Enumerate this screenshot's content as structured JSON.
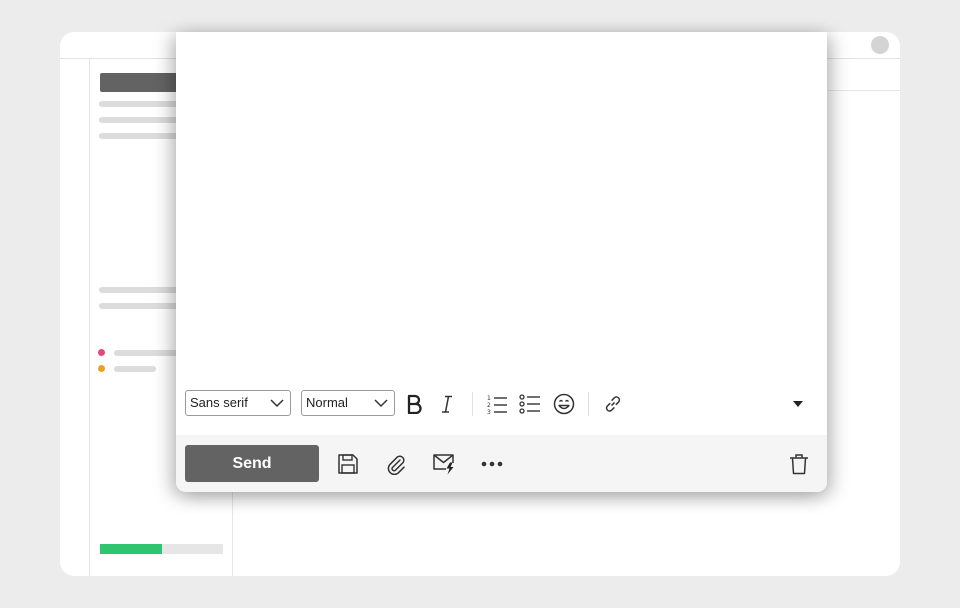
{
  "colors": {
    "background": "#ececec",
    "skeleton": "#dcdcdc",
    "button_dark": "#636363",
    "tag_pink": "#e8467c",
    "tag_orange": "#f0a020",
    "storage_green": "#2fc46f"
  },
  "sidebar": {
    "storage_used_fraction": 0.5
  },
  "compose": {
    "font_select": {
      "value": "Sans serif"
    },
    "size_select": {
      "value": "Normal"
    },
    "toolbar_icons": [
      "bold-icon",
      "italic-icon",
      "numbered-list-icon",
      "bulleted-list-icon",
      "emoji-icon",
      "link-icon",
      "more-formatting-icon"
    ],
    "send_label": "Send",
    "bottom_icons": [
      "save-icon",
      "attachment-icon",
      "confidential-icon",
      "more-options-icon",
      "trash-icon"
    ]
  }
}
